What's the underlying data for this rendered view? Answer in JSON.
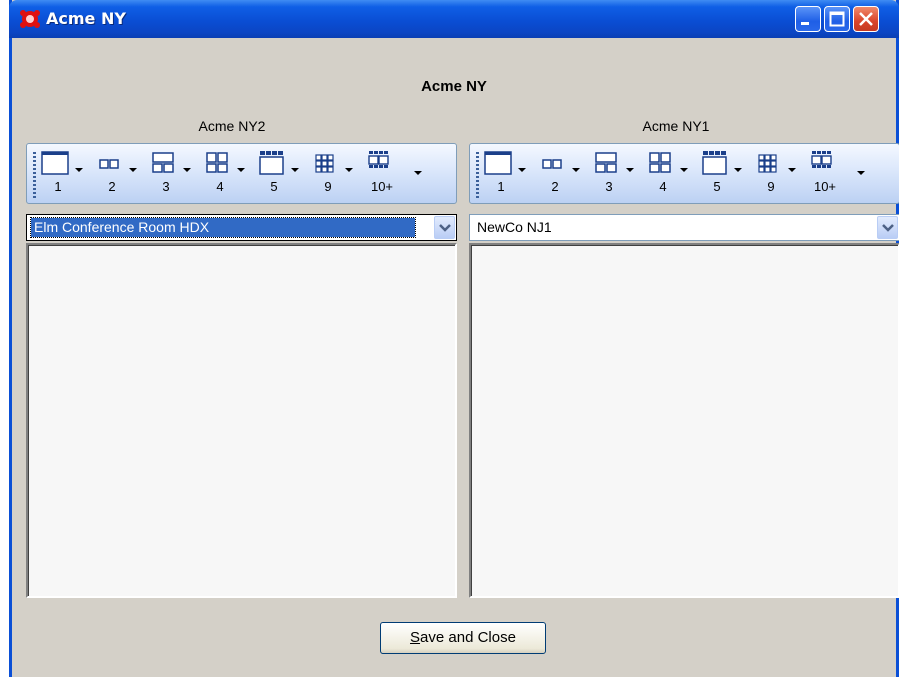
{
  "window": {
    "title": "Acme NY",
    "buttons": {
      "minimize": "minimize-icon",
      "maximize": "maximize-icon",
      "close": "close-icon"
    }
  },
  "header": {
    "title": "Acme NY"
  },
  "layout_buttons": [
    "1",
    "2",
    "3",
    "4",
    "5",
    "9",
    "10+"
  ],
  "panels": [
    {
      "label": "Acme NY2",
      "selected_room": "Elm Conference Room HDX"
    },
    {
      "label": "Acme NY1",
      "selected_room": "NewCo NJ1"
    }
  ],
  "footer": {
    "save_label_first": "S",
    "save_label_rest": "ave and Close"
  },
  "colors": {
    "titlebar": "#0a4ed4",
    "window_bg": "#d4d0c8",
    "selection": "#316ac5",
    "toolbar": "#dbe7fb"
  }
}
